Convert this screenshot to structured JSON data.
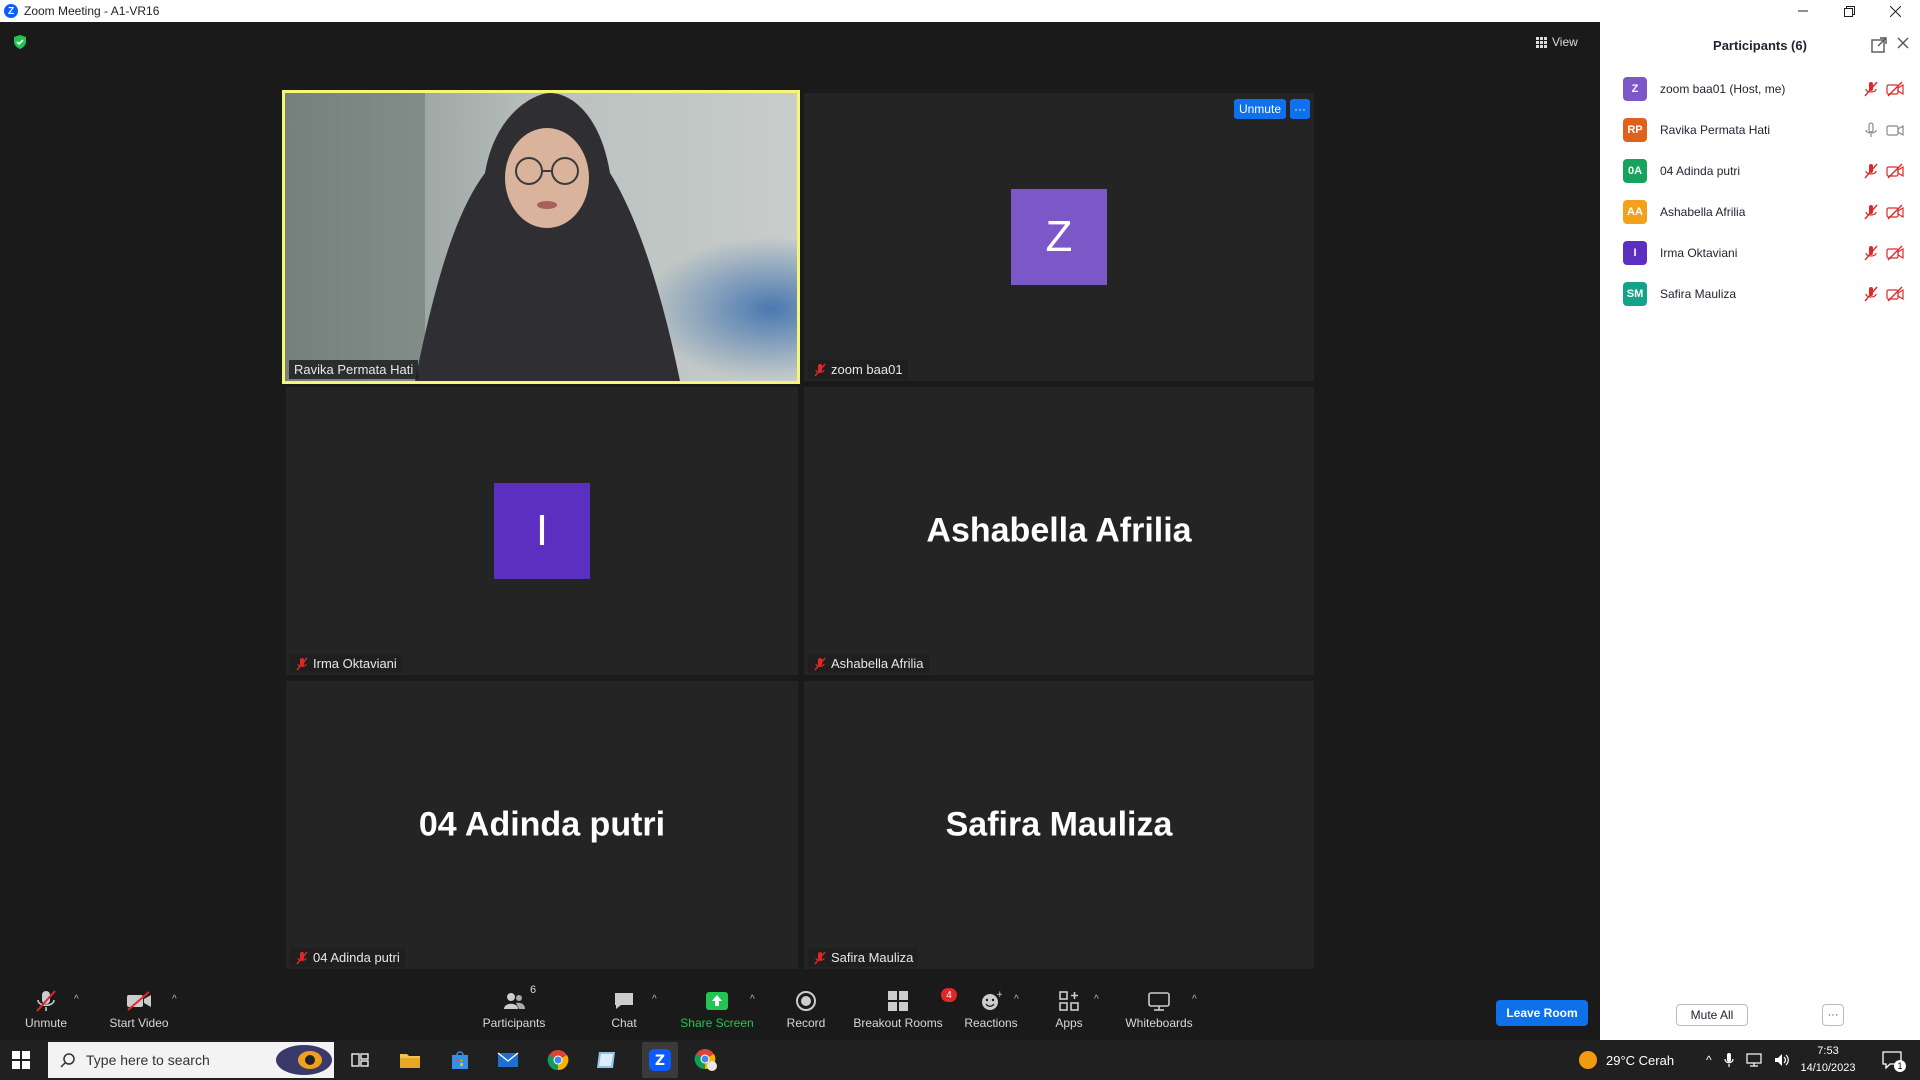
{
  "window": {
    "title": "Zoom Meeting - A1-VR16",
    "logo_letter": "Z"
  },
  "meeting": {
    "view_label": "View",
    "tiles": [
      {
        "name": "Ravika Permata Hati",
        "type": "video",
        "active_speaker": true
      },
      {
        "name": "zoom baa01",
        "type": "avatar",
        "avatar_letter": "Z",
        "avatar_color": "#7b57c8",
        "muted": true
      },
      {
        "name": "Irma Oktaviani",
        "type": "avatar",
        "avatar_letter": "I",
        "avatar_color": "#5b2fc0",
        "muted": true
      },
      {
        "name": "Ashabella Afrilia",
        "type": "name",
        "muted": true
      },
      {
        "name": "04 Adinda putri",
        "type": "name",
        "muted": true
      },
      {
        "name": "Safira Mauliza",
        "type": "name",
        "muted": true
      }
    ],
    "hover_unmute_label": "Unmute",
    "hover_more_label": "···"
  },
  "toolbar": {
    "unmute": "Unmute",
    "start_video": "Start Video",
    "participants": "Participants",
    "participants_count": "6",
    "chat": "Chat",
    "share_screen": "Share Screen",
    "record": "Record",
    "breakout_rooms": "Breakout Rooms",
    "breakout_badge": "4",
    "reactions": "Reactions",
    "apps": "Apps",
    "whiteboards": "Whiteboards",
    "leave_room": "Leave Room"
  },
  "panel": {
    "title": "Participants (6)",
    "participants": [
      {
        "initials": "Z",
        "name": "zoom baa01 (Host, me)",
        "color": "#7b57c8",
        "muted": true,
        "video_off": true
      },
      {
        "initials": "RP",
        "name": "Ravika Permata Hati",
        "color": "#e0611b",
        "muted": false,
        "video_off": false
      },
      {
        "initials": "0A",
        "name": "04 Adinda putri",
        "color": "#16a35b",
        "muted": true,
        "video_off": true
      },
      {
        "initials": "AA",
        "name": "Ashabella Afrilia",
        "color": "#f4a21c",
        "muted": true,
        "video_off": true
      },
      {
        "initials": "I",
        "name": "Irma Oktaviani",
        "color": "#5b2fc0",
        "muted": true,
        "video_off": true
      },
      {
        "initials": "SM",
        "name": "Safira Mauliza",
        "color": "#14a38a",
        "muted": true,
        "video_off": true
      }
    ],
    "mute_all": "Mute All",
    "more": "···"
  },
  "taskbar": {
    "search_placeholder": "Type here to search",
    "weather": "29°C  Cerah",
    "time": "7:53",
    "date": "14/10/2023",
    "notification_count": "1"
  },
  "colors": {
    "zoom_blue": "#0e71eb",
    "active_speaker_border": "#f5f578",
    "share_green": "#23c552",
    "muted_red": "#e02828"
  }
}
